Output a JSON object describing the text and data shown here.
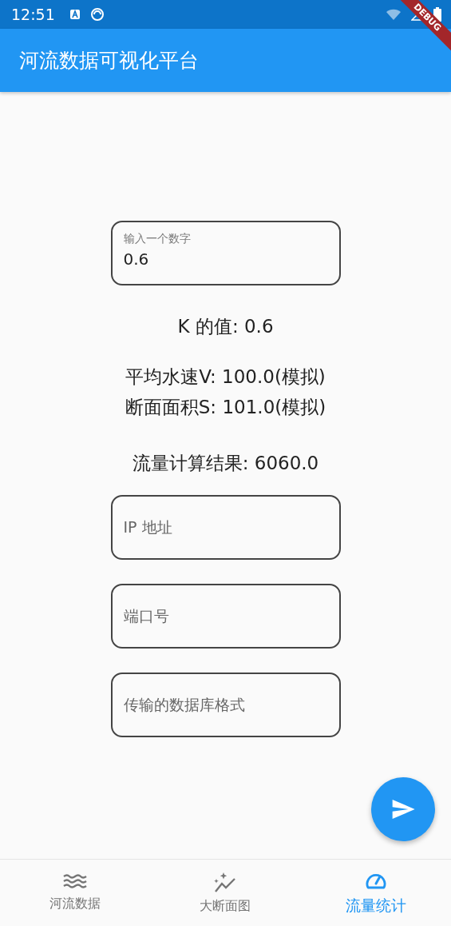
{
  "status_bar": {
    "time": "12:51"
  },
  "debug_banner": {
    "label": "DEBUG"
  },
  "app_bar": {
    "title": "河流数据可视化平台"
  },
  "k_field": {
    "label": "输入一个数字",
    "value": "0.6"
  },
  "results": [
    {
      "kind": "single",
      "text": "K 的值: 0.6"
    },
    {
      "kind": "pair",
      "lines": [
        "平均水速V: 100.0(模拟)",
        "断面面积S: 101.0(模拟)"
      ]
    },
    {
      "kind": "single",
      "text": "流量计算结果: 6060.0"
    }
  ],
  "fields": [
    {
      "placeholder": "IP 地址"
    },
    {
      "placeholder": "端口号"
    },
    {
      "placeholder": "传输的数据库格式"
    }
  ],
  "bottom_nav": [
    {
      "label": "河流数据",
      "kind": "waves",
      "selected": false
    },
    {
      "label": "大断面图",
      "kind": "chart",
      "selected": false
    },
    {
      "label": "流量统计",
      "kind": "gauge",
      "selected": true
    }
  ]
}
